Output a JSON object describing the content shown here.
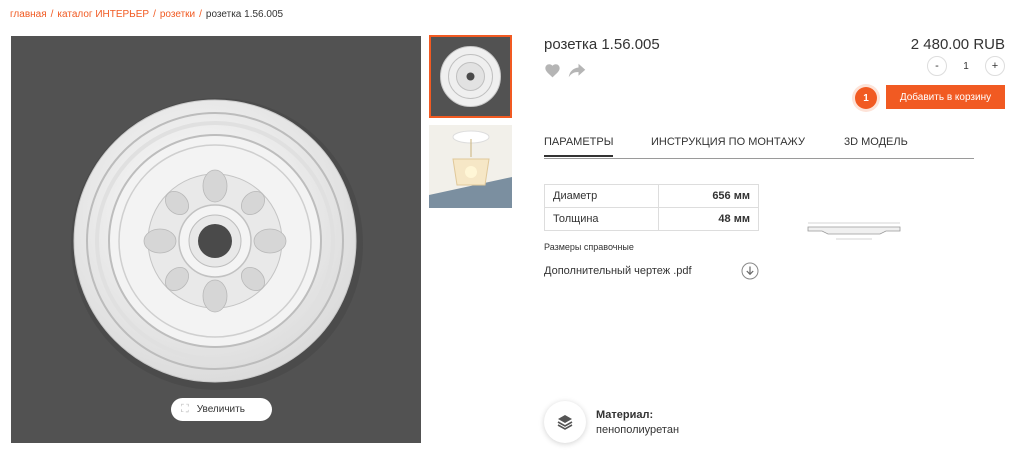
{
  "breadcrumb": {
    "items": [
      "главная",
      "каталог ИНТЕРЬЕР",
      "розетки"
    ],
    "current": "розетка 1.56.005",
    "separator": "/"
  },
  "product": {
    "title": "розетка 1.56.005",
    "price": "2 480.00 RUB"
  },
  "quantity": {
    "minus": "-",
    "value": "1",
    "plus": "+"
  },
  "cart": {
    "badge": "1",
    "button_label": "Добавить в корзину"
  },
  "tabs": [
    {
      "label": "ПАРАМЕТРЫ",
      "active": true
    },
    {
      "label": "ИНСТРУКЦИЯ ПО МОНТАЖУ",
      "active": false
    },
    {
      "label": "3D МОДЕЛЬ",
      "active": false
    }
  ],
  "params": [
    {
      "name": "Диаметр",
      "value": "656 мм"
    },
    {
      "name": "Толщина",
      "value": "48 мм"
    }
  ],
  "note": "Размеры справочные",
  "pdf_link": "Дополнительный чертеж .pdf",
  "zoom_label": "Увеличить",
  "material": {
    "label": "Материал:",
    "value": "пенополиуретан"
  },
  "icons": {
    "favorite": "heart-icon",
    "share": "share-arrow-icon",
    "download": "download-circle-icon",
    "zoom": "expand-icon",
    "material": "layers-icon"
  },
  "colors": {
    "accent": "#f15a22",
    "image_bg": "#525252"
  }
}
